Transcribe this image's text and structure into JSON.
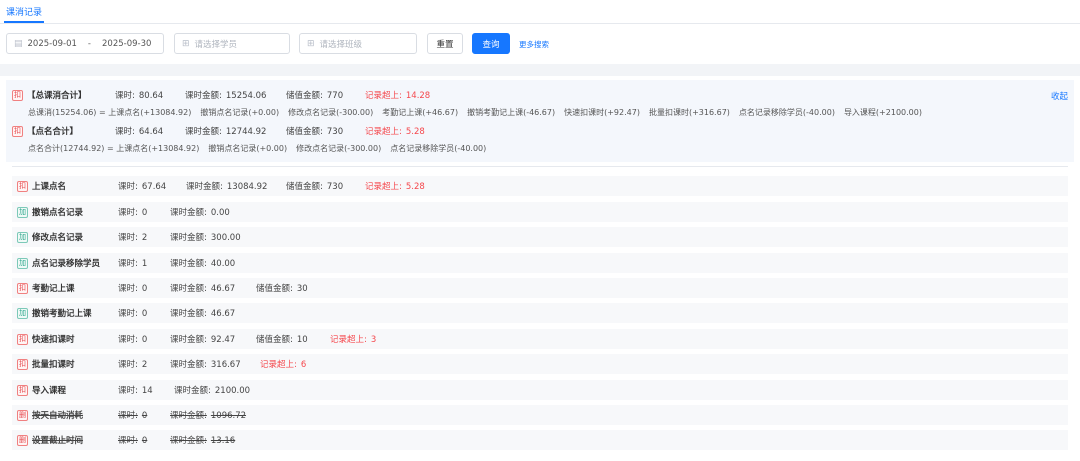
{
  "tabs": [
    {
      "label": "课消记录",
      "active": true
    }
  ],
  "filters": {
    "date_start": "2025-09-01",
    "date_sep": "-",
    "date_end": "2025-09-30",
    "student_placeholder": "请选择学员",
    "class_placeholder": "请选择班级",
    "reset_label": "重置",
    "query_label": "查询",
    "more_label": "更多搜索"
  },
  "summary": {
    "collapse_label": "收起",
    "total": {
      "badge": "扣",
      "title": "【总课消合计】",
      "hours_label": "课时:",
      "hours": "80.64",
      "amount_label": "课时金额:",
      "amount": "15254.06",
      "stored_label": "储值金额:",
      "stored": "770",
      "over_label": "记录超上:",
      "over": "14.28",
      "formula_head": "总课消(15254.06) = 上课点名(+13084.92)",
      "formula_items": [
        "撤销点名记录(+0.00)",
        "修改点名记录(-300.00)",
        "考勤记上课(+46.67)",
        "撤销考勤记上课(-46.67)",
        "快速扣课时(+92.47)",
        "批量扣课时(+316.67)",
        "点名记录移除学员(-40.00)",
        "导入课程(+2100.00)"
      ]
    },
    "rollcall": {
      "badge": "扣",
      "title": "【点名合计】",
      "hours_label": "课时:",
      "hours": "64.64",
      "amount_label": "课时金额:",
      "amount": "12744.92",
      "stored_label": "储值金额:",
      "stored": "730",
      "over_label": "记录超上:",
      "over": "5.28",
      "formula_head": "点名合计(12744.92) = 上课点名(+13084.92)",
      "formula_items": [
        "撤销点名记录(+0.00)",
        "修改点名记录(-300.00)",
        "点名记录移除学员(-40.00)"
      ]
    }
  },
  "rows": [
    {
      "badge": "扣",
      "name": "上课点名",
      "hours_label": "课时:",
      "hours": "67.64",
      "amount_label": "课时金额:",
      "amount": "13084.92",
      "stored_label": "储值金额:",
      "stored": "730",
      "over_label": "记录超上:",
      "over": "5.28"
    },
    {
      "badge": "加",
      "name": "撤销点名记录",
      "hours_label": "课时:",
      "hours": "0",
      "amount_label": "课时金额:",
      "amount": "0.00"
    },
    {
      "badge": "加",
      "name": "修改点名记录",
      "hours_label": "课时:",
      "hours": "2",
      "amount_label": "课时金额:",
      "amount": "300.00"
    },
    {
      "badge": "加",
      "name": "点名记录移除学员",
      "hours_label": "课时:",
      "hours": "1",
      "amount_label": "课时金额:",
      "amount": "40.00"
    },
    {
      "badge": "扣",
      "name": "考勤记上课",
      "hours_label": "课时:",
      "hours": "0",
      "amount_label": "课时金额:",
      "amount": "46.67",
      "stored_label": "储值金额:",
      "stored": "30"
    },
    {
      "badge": "加",
      "name": "撤销考勤记上课",
      "hours_label": "课时:",
      "hours": "0",
      "amount_label": "课时金额:",
      "amount": "46.67"
    },
    {
      "badge": "扣",
      "name": "快速扣课时",
      "hours_label": "课时:",
      "hours": "0",
      "amount_label": "课时金额:",
      "amount": "92.47",
      "stored_label": "储值金额:",
      "stored": "10",
      "over_label": "记录超上:",
      "over": "3"
    },
    {
      "badge": "扣",
      "name": "批量扣课时",
      "hours_label": "课时:",
      "hours": "2",
      "amount_label": "课时金额:",
      "amount": "316.67",
      "over_label": "记录超上:",
      "over": "6"
    },
    {
      "badge": "扣",
      "name": "导入课程",
      "hours_label": "课时:",
      "hours": "14",
      "amount_label": "课时金额:",
      "amount": "2100.00"
    },
    {
      "badge": "删",
      "name": "按天自动消耗",
      "hours_label": "课时:",
      "hours": "0",
      "amount_label": "课时金额:",
      "amount": "1096.72"
    },
    {
      "badge": "删",
      "name": "设置截止时间",
      "hours_label": "课时:",
      "hours": "0",
      "amount_label": "课时金额:",
      "amount": "13.16"
    }
  ],
  "colors": {
    "accent": "#1677ff",
    "deduct": "#e5484d",
    "add": "#2ba58b",
    "over": "#f5484d"
  }
}
